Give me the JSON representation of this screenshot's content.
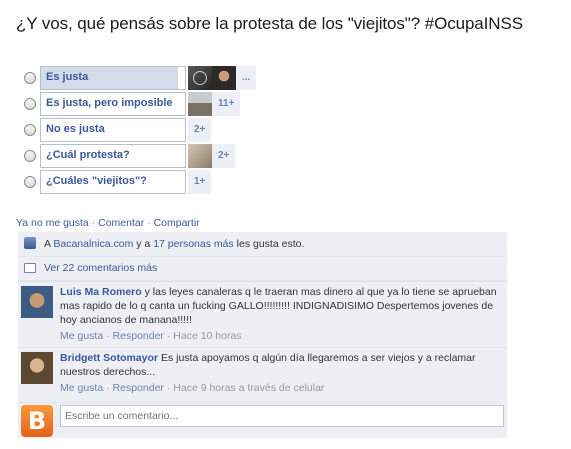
{
  "question": "¿Y vos, qué pensás sobre la protesta de los \"viejitos\"? #OcupaINSS",
  "poll": {
    "options": [
      {
        "label": "Es justa",
        "fill": 0.95,
        "count": "..."
      },
      {
        "label": "Es justa, pero imposible",
        "fill": 0,
        "count": "11+"
      },
      {
        "label": "No es justa",
        "fill": 0,
        "count": "2+"
      },
      {
        "label": "¿Cuál protesta?",
        "fill": 0,
        "count": "2+"
      },
      {
        "label": "¿Cuáles \"viejitos\"?",
        "fill": 0,
        "count": "1+"
      }
    ]
  },
  "actions": {
    "unlike": "Ya no me gusta",
    "comment": "Comentar",
    "share": "Compartir",
    "sep": "·"
  },
  "likes": {
    "prefix": "A",
    "page": "Bacanalnica.com",
    "middle": "y a",
    "people": "17 personas más",
    "suffix": "les gusta esto."
  },
  "view_comments": "Ver 22 comentarios más",
  "comments": [
    {
      "name": "Luis Ma Romero",
      "text": "y las leyes canaleras q le traeran mas dinero al que ya lo tiene se aprueban mas rapido de lo q canta un fucking GALLO!!!!!!!!! INDIGNADISIMO Despertemos jovenes de hoy ancianos de manana!!!!!",
      "like": "Me gusta",
      "reply": "Responder",
      "time": "Hace 10 horas"
    },
    {
      "name": "Bridgett Sotomayor",
      "text": "Es justa apoyamos q algún día llegaremos a ser viejos y a reclamar nuestros derechos...",
      "like": "Me gusta",
      "reply": "Responder",
      "time": "Hace 9 horas a través de celular"
    }
  ],
  "composer": {
    "placeholder": "Escribe un comentario...",
    "avatar_letter": "B"
  },
  "colors": {
    "link": "#3b5998",
    "ufi_bg": "#edeff4",
    "poll_fill": "#d4dbe9",
    "brand_orange": "#f0802a"
  }
}
